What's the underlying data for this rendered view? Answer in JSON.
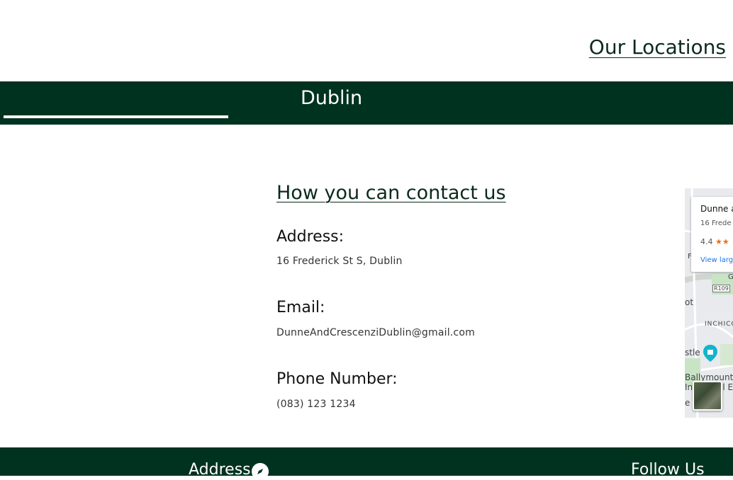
{
  "header": {
    "title": "Our Locations"
  },
  "city_tabs": {
    "active_city": "Dublin"
  },
  "contact": {
    "title": "How you can contact us",
    "address_label": "Address:",
    "address_value": "16 Frederick St S, Dublin",
    "email_label": "Email:",
    "email_value": "DunneAndCrescenziDublin@gmail.com",
    "phone_label": "Phone Number:",
    "phone_value": "(083) 123 1234"
  },
  "map": {
    "card_name": "Dunne a",
    "card_address": "16 Frede",
    "rating": "4.4",
    "stars": "★★",
    "view_larger": "View larg",
    "road_label": "R109",
    "place_labels": [
      "F",
      "G",
      "ot",
      "INCHICO",
      "stle",
      "Ballymount",
      "In",
      "al E",
      "e"
    ]
  },
  "footer": {
    "address_heading": "Address",
    "follow_heading": "Follow Us"
  },
  "colors": {
    "brand_green": "#003220",
    "link_blue": "#1a73e8",
    "star_orange": "#e7711b"
  }
}
